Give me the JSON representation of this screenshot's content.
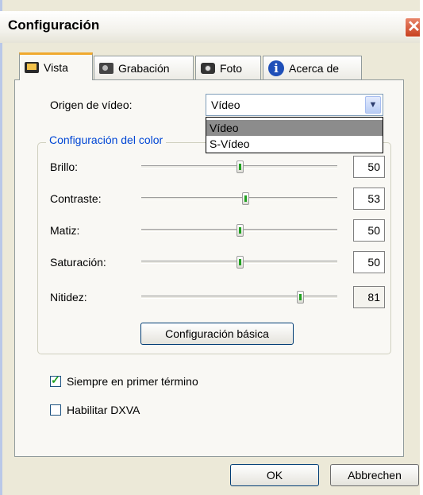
{
  "window": {
    "title": "Configuración",
    "close_symbol": "✕"
  },
  "tabs": [
    {
      "label": "Vista",
      "icon": "tv-icon"
    },
    {
      "label": "Grabación",
      "icon": "camcorder-icon"
    },
    {
      "label": "Foto",
      "icon": "camera-icon"
    },
    {
      "label": "Acerca de",
      "icon": "info-icon"
    }
  ],
  "video_source": {
    "label": "Origen de vídeo:",
    "value": "Vídeo",
    "options": [
      "Vídeo",
      "S-Vídeo"
    ]
  },
  "color_group": {
    "title": "Configuración del color",
    "sliders": [
      {
        "label": "Brillo:",
        "value": "50",
        "fraction": 0.5
      },
      {
        "label": "Contraste:",
        "value": "53",
        "fraction": 0.53
      },
      {
        "label": "Matiz:",
        "value": "50",
        "fraction": 0.5
      },
      {
        "label": "Saturación:",
        "value": "50",
        "fraction": 0.5
      },
      {
        "label": "Nitidez:",
        "value": "81",
        "fraction": 0.81
      }
    ],
    "basic_button": "Configuración básica"
  },
  "options": {
    "always_on_top": {
      "label": "Siempre en primer término",
      "checked": true
    },
    "dxva": {
      "label": "Habilitar DXVA",
      "checked": false
    }
  },
  "buttons": {
    "ok": "OK",
    "cancel": "Abbrechen"
  }
}
